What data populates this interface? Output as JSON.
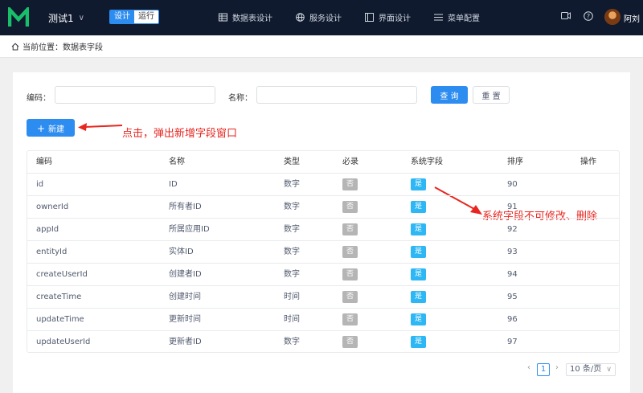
{
  "header": {
    "app_name": "测试1",
    "mode_design": "设计",
    "mode_run": "运行",
    "nav": [
      {
        "label": "数据表设计",
        "icon": "table-icon"
      },
      {
        "label": "服务设计",
        "icon": "globe-icon"
      },
      {
        "label": "界面设计",
        "icon": "layout-icon"
      },
      {
        "label": "菜单配置",
        "icon": "menu-icon"
      }
    ],
    "user_name": "阿刘"
  },
  "breadcrumb": {
    "text": "当前位置：数据表字段"
  },
  "search": {
    "code_label": "编码：",
    "code_value": "",
    "name_label": "名称：",
    "name_value": "",
    "query_button": "查 询",
    "reset_button": "重 置"
  },
  "toolbar": {
    "add_button": "新建"
  },
  "annotations": {
    "add_hint": "点击，弹出新增字段窗口",
    "system_hint": "系统字段不可修改、删除"
  },
  "table": {
    "columns": [
      "编码",
      "名称",
      "类型",
      "必录",
      "系统字段",
      "排序",
      "操作"
    ],
    "rows": [
      {
        "code": "id",
        "name": "ID",
        "type": "数字",
        "required": "否",
        "system": "是",
        "order": "90"
      },
      {
        "code": "ownerId",
        "name": "所有者ID",
        "type": "数字",
        "required": "否",
        "system": "是",
        "order": "91"
      },
      {
        "code": "appId",
        "name": "所属应用ID",
        "type": "数字",
        "required": "否",
        "system": "是",
        "order": "92"
      },
      {
        "code": "entityId",
        "name": "实体ID",
        "type": "数字",
        "required": "否",
        "system": "是",
        "order": "93"
      },
      {
        "code": "createUserId",
        "name": "创建者ID",
        "type": "数字",
        "required": "否",
        "system": "是",
        "order": "94"
      },
      {
        "code": "createTime",
        "name": "创建时间",
        "type": "时间",
        "required": "否",
        "system": "是",
        "order": "95"
      },
      {
        "code": "updateTime",
        "name": "更新时间",
        "type": "时间",
        "required": "否",
        "system": "是",
        "order": "96"
      },
      {
        "code": "updateUserId",
        "name": "更新者ID",
        "type": "数字",
        "required": "否",
        "system": "是",
        "order": "97"
      }
    ]
  },
  "pagination": {
    "current_page": "1",
    "page_size": "10 条/页"
  },
  "colors": {
    "primary": "#2d8cf0",
    "annotation": "#e8261f",
    "tag_yes": "#2db7f5",
    "tag_no": "#b5b5b5",
    "topbar": "#0f1a2e"
  }
}
